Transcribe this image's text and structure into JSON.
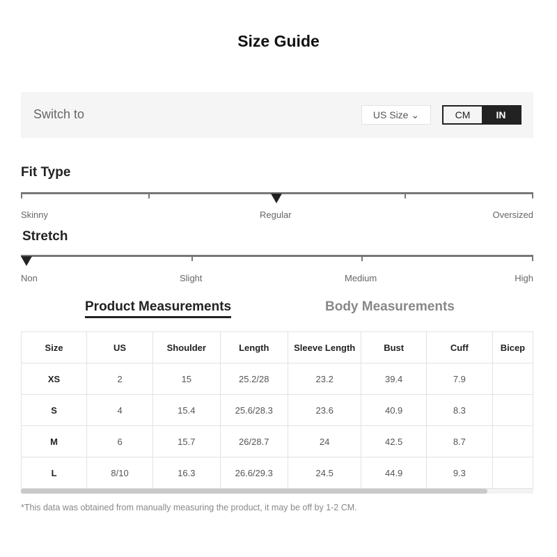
{
  "title": "Size Guide",
  "switch": {
    "label": "Switch to",
    "size_select": "US Size",
    "units": [
      "CM",
      "IN"
    ],
    "selected_unit": "IN"
  },
  "fit": {
    "title": "Fit Type",
    "labels": [
      "Skinny",
      "Regular",
      "Oversized"
    ],
    "selected": "Regular"
  },
  "stretch": {
    "title": "Stretch",
    "labels": [
      "Non",
      "Slight",
      "Medium",
      "High"
    ],
    "selected": "Non"
  },
  "tabs": [
    {
      "label": "Product Measurements",
      "active": true
    },
    {
      "label": "Body Measurements",
      "active": false
    }
  ],
  "table": {
    "headers": [
      "Size",
      "US",
      "Shoulder",
      "Length",
      "Sleeve Length",
      "Bust",
      "Cuff",
      "Bicep"
    ],
    "rows": [
      [
        "XS",
        "2",
        "15",
        "25.2/28",
        "23.2",
        "39.4",
        "7.9",
        ""
      ],
      [
        "S",
        "4",
        "15.4",
        "25.6/28.3",
        "23.6",
        "40.9",
        "8.3",
        ""
      ],
      [
        "M",
        "6",
        "15.7",
        "26/28.7",
        "24",
        "42.5",
        "8.7",
        ""
      ],
      [
        "L",
        "8/10",
        "16.3",
        "26.6/29.3",
        "24.5",
        "44.9",
        "9.3",
        ""
      ]
    ]
  },
  "note": "*This data was obtained from manually measuring the product, it may be off by 1-2 CM."
}
